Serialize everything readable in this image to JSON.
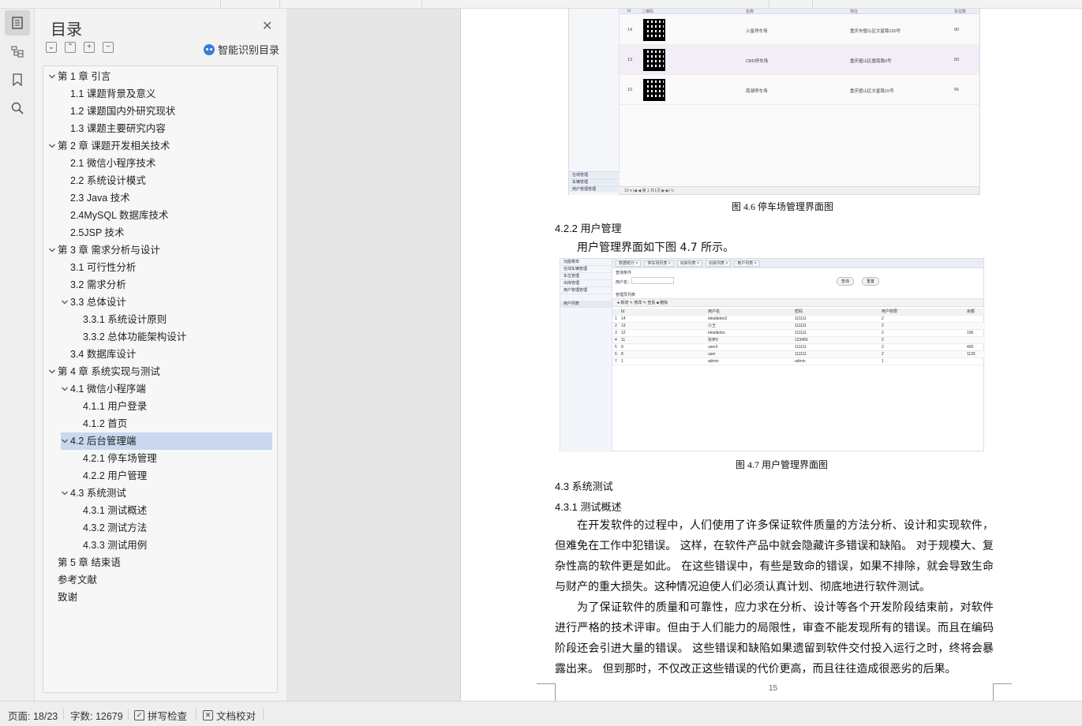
{
  "toc": {
    "title": "目录",
    "ai_label": "智能识别目录",
    "items": [
      {
        "label": "第 1 章  引言",
        "level": 0,
        "expanded": true
      },
      {
        "label": "1.1  课题背景及意义",
        "level": 1
      },
      {
        "label": "1.2  课题国内外研究现状",
        "level": 1
      },
      {
        "label": "1.3  课题主要研究内容",
        "level": 1
      },
      {
        "label": "第 2 章  课题开发相关技术",
        "level": 0,
        "expanded": true
      },
      {
        "label": "2.1  微信小程序技术",
        "level": 1
      },
      {
        "label": "2.2  系统设计模式",
        "level": 1
      },
      {
        "label": "2.3 Java 技术",
        "level": 1
      },
      {
        "label": "2.4MySQL 数据库技术",
        "level": 1
      },
      {
        "label": "2.5JSP 技术",
        "level": 1
      },
      {
        "label": "第 3 章  需求分析与设计",
        "level": 0,
        "expanded": true
      },
      {
        "label": "3.1  可行性分析",
        "level": 1
      },
      {
        "label": "3.2  需求分析",
        "level": 1
      },
      {
        "label": "3.3  总体设计",
        "level": 1,
        "expanded": true
      },
      {
        "label": "3.3.1  系统设计原则",
        "level": 2
      },
      {
        "label": "3.3.2  总体功能架构设计",
        "level": 2
      },
      {
        "label": "3.4  数据库设计",
        "level": 1
      },
      {
        "label": "第 4 章  系统实现与测试",
        "level": 0,
        "expanded": true
      },
      {
        "label": "4.1  微信小程序端",
        "level": 1,
        "expanded": true
      },
      {
        "label": "4.1.1  用户登录",
        "level": 2
      },
      {
        "label": "4.1.2 首页",
        "level": 2
      },
      {
        "label": "4.2  后台管理端",
        "level": 1,
        "expanded": true,
        "active": true
      },
      {
        "label": "4.2.1  停车场管理",
        "level": 2
      },
      {
        "label": "4.2.2  用户管理",
        "level": 2
      },
      {
        "label": "4.3  系统测试",
        "level": 1,
        "expanded": true
      },
      {
        "label": "4.3.1  测试概述",
        "level": 2
      },
      {
        "label": "4.3.2  测试方法",
        "level": 2
      },
      {
        "label": "4.3.3  测试用例",
        "level": 2
      },
      {
        "label": "第 5 章  结束语",
        "level": 0
      },
      {
        "label": "参考文献",
        "level": 0
      },
      {
        "label": "致谢",
        "level": 0
      }
    ]
  },
  "document": {
    "shot1": {
      "headers": [
        "Id",
        "二维码",
        "名称",
        "地址",
        "车位数"
      ],
      "rows": [
        {
          "id": "14",
          "name": "火星停车场",
          "addr": "重庆市璧山区文星路100号",
          "slots": "90"
        },
        {
          "id": "13",
          "name": "CBD停车场",
          "addr": "重庆璧山区璧南路9号",
          "slots": "50"
        },
        {
          "id": "10",
          "name": "南湖停车场",
          "addr": "重庆璧山区文星路15号",
          "slots": "56"
        }
      ],
      "nav": [
        "在线管理",
        "车辆管理",
        "用户管理管理"
      ],
      "pager": "10 ▾   |◀  ◀   第 1   共1页   ▶  ▶|   ↻"
    },
    "caption1": "图 4.6 停车场管理界面图",
    "heading_422": "4.2.2  用户管理",
    "para_422": "用户管理界面如下图 4.7 所示。",
    "shot2": {
      "side": [
        "功能菜单",
        "在线车辆管理",
        "车位管理",
        "出库管理",
        "用户管理管理",
        "用户列表"
      ],
      "tabs": [
        "数据统计 ×",
        "停车场列表 ×",
        "出库列表 ×",
        "出库列表 ×",
        "用户列表 ×"
      ],
      "search_title": "查询条件",
      "search_label": "用户名：",
      "search_btn": "查询",
      "reset_btn": "重置",
      "list_title": "管理员列表",
      "toolbar": "● 新增    ✎ 修改    ✎ 查看    ■ 删除",
      "headers": [
        "Id",
        "用户名",
        "密码",
        "用户权限",
        "余额"
      ],
      "rows": [
        [
          "1",
          "14",
          "idealbobo2",
          "111111",
          "2",
          ""
        ],
        [
          "2",
          "13",
          "小王",
          "111111",
          "2",
          ""
        ],
        [
          "3",
          "12",
          "idealbobo",
          "111111",
          "2",
          "196"
        ],
        [
          "4",
          "11",
          "张伊3",
          "123456",
          "2",
          ""
        ],
        [
          "5",
          "9",
          "user3",
          "111111",
          "2",
          "400"
        ],
        [
          "6",
          "8",
          "user",
          "111111",
          "2",
          "1126"
        ],
        [
          "7",
          "1",
          "admin",
          "admin",
          "1",
          ""
        ]
      ]
    },
    "caption2": "图 4.7 用户管理界面图",
    "heading_43": "4.3  系统测试",
    "heading_431": "4.3.1  测试概述",
    "para1": "在开发软件的过程中，人们使用了许多保证软件质量的方法分析、设计和实现软件，但难免在工作中犯错误。 这样，在软件产品中就会隐藏许多错误和缺陷。 对于规模大、复杂性高的软件更是如此。 在这些错误中，有些是致命的错误，如果不排除，就会导致生命与财产的重大损失。这种情况迫使人们必须认真计划、彻底地进行软件测试。",
    "para2": "为了保证软件的质量和可靠性，应力求在分析、设计等各个开发阶段结束前，对软件进行严格的技术评审。但由于人们能力的局限性，审查不能发现所有的错误。而且在编码阶段还会引进大量的错误。 这些错误和缺陷如果遗留到软件交付投入运行之时，终将会暴露出来。 但到那时，不仅改正这些错误的代价更高，而且往往造成很恶劣的后果。",
    "page_number": "15"
  },
  "status": {
    "page": "页面: 18/23",
    "words": "字数: 12679",
    "spell": "拼写检查",
    "proof": "文档校对"
  }
}
